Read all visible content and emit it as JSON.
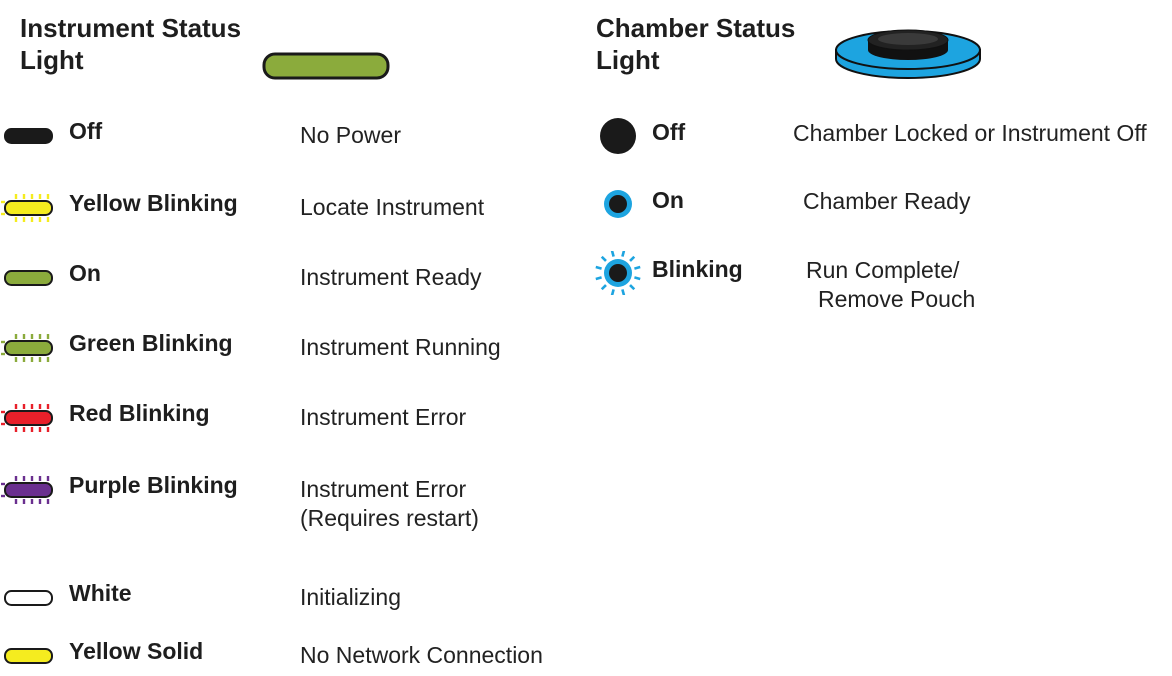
{
  "instrument": {
    "title_line1": "Instrument Status",
    "title_line2": "Light",
    "header_bar_color": "#8bab3c",
    "rows": [
      {
        "label": "Off",
        "description": [
          "No Power"
        ],
        "color": "#1a1a1a",
        "fill": "solid",
        "blinking": false
      },
      {
        "label": "Yellow Blinking",
        "description": [
          "Locate Instrument"
        ],
        "color": "#f5ec1f",
        "fill": "solid",
        "blinking": true
      },
      {
        "label": "On",
        "description": [
          "Instrument Ready"
        ],
        "color": "#8bab3c",
        "fill": "solid",
        "blinking": false
      },
      {
        "label": "Green Blinking",
        "description": [
          "Instrument Running"
        ],
        "color": "#8bab3c",
        "fill": "solid",
        "blinking": true
      },
      {
        "label": "Red Blinking",
        "description": [
          "Instrument Error"
        ],
        "color": "#e8202a",
        "fill": "solid",
        "blinking": true
      },
      {
        "label": "Purple Blinking",
        "description": [
          "Instrument Error",
          "(Requires restart)"
        ],
        "color": "#6a2f8f",
        "fill": "solid",
        "blinking": true
      },
      {
        "label": "White",
        "description": [
          "Initializing"
        ],
        "color": "#ffffff",
        "fill": "outline",
        "blinking": false
      },
      {
        "label": "Yellow Solid",
        "description": [
          "No Network Connection"
        ],
        "color": "#f5ec1f",
        "fill": "solid",
        "blinking": false
      }
    ]
  },
  "chamber": {
    "title_line1": "Chamber Status",
    "title_line2": "Light",
    "icon_color": "#1da4e0",
    "rows": [
      {
        "label": "Off",
        "description": [
          "Chamber Locked or Instrument Off"
        ],
        "state": "off"
      },
      {
        "label": "On",
        "description": [
          "Chamber Ready"
        ],
        "state": "on"
      },
      {
        "label": "Blinking",
        "description": [
          "Run Complete/",
          "Remove Pouch"
        ],
        "state": "blinking"
      }
    ]
  }
}
